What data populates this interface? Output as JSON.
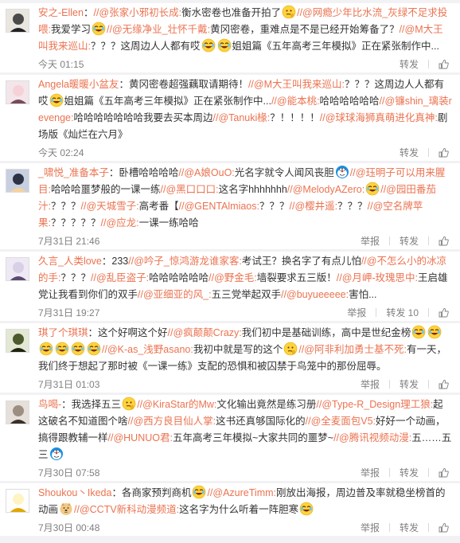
{
  "comments": [
    {
      "user": "安之-Ellen",
      "segments": [
        {
          "t": "p",
          "v": "："
        },
        {
          "t": "m",
          "v": "//@张家小邪初长成:"
        },
        {
          "t": "p",
          "v": "衡水密卷也准备开拍了"
        },
        {
          "t": "e",
          "v": "think"
        },
        {
          "t": "m",
          "v": "//@网瘾少年比水流_灰绿不足求投喂:"
        },
        {
          "t": "p",
          "v": "我爱学习"
        },
        {
          "t": "e",
          "v": "lol"
        },
        {
          "t": "m",
          "v": "//@无缘净业_壮怀千戴:"
        },
        {
          "t": "p",
          "v": "黄冈密卷，重难点是不是已经开始筹备了？"
        },
        {
          "t": "m",
          "v": "//@M大王叫我来巡山:"
        },
        {
          "t": "p",
          "v": "？？？这周边人人都有哎"
        },
        {
          "t": "e",
          "v": "lol"
        },
        {
          "t": "e",
          "v": "lol"
        },
        {
          "t": "p",
          "v": "姐姐篇《五年高考三年模拟》正在紧张制作中..."
        }
      ],
      "time": "今天 01:15",
      "actions": [
        "转发",
        "赞"
      ]
    },
    {
      "user": "Angela暖暖小盆友",
      "segments": [
        {
          "t": "p",
          "v": "：黄冈密卷超强藕取请期待！"
        },
        {
          "t": "m",
          "v": "//@M大王叫我来巡山:"
        },
        {
          "t": "p",
          "v": "？？？这周边人人都有哎"
        },
        {
          "t": "e",
          "v": "lol"
        },
        {
          "t": "p",
          "v": "姐姐篇《五年高考三年模拟》正在紧张制作中..."
        },
        {
          "t": "m",
          "v": "//@能本桃:"
        },
        {
          "t": "p",
          "v": "哈哈哈哈哈哈"
        },
        {
          "t": "m",
          "v": "//@镰shin_璃装revenge:"
        },
        {
          "t": "p",
          "v": "哈哈哈哈哈哈哈我要去买本周边"
        },
        {
          "t": "m",
          "v": "//@Tanuki椽:"
        },
        {
          "t": "p",
          "v": "？！！！！"
        },
        {
          "t": "m",
          "v": "//@球球海狮真萌进化真神:"
        },
        {
          "t": "p",
          "v": "剧场版《灿烂在六月》"
        }
      ],
      "time": "今天 02:24",
      "actions": [
        "转发",
        "赞"
      ]
    },
    {
      "user": "_啸悦_准备本子",
      "segments": [
        {
          "t": "p",
          "v": "：卧槽哈哈哈哈"
        },
        {
          "t": "m",
          "v": "//@A娘OuO:"
        },
        {
          "t": "p",
          "v": "光名字就令人闻风丧胆"
        },
        {
          "t": "e",
          "v": "doraemon"
        },
        {
          "t": "m",
          "v": "//@珏明子可以用来腥目:"
        },
        {
          "t": "p",
          "v": "哈哈哈噩梦般的一课一练"
        },
        {
          "t": "m",
          "v": "//@黑口口口:"
        },
        {
          "t": "p",
          "v": "这名字hhhhhhh"
        },
        {
          "t": "m",
          "v": "//@MelodyAZero:"
        },
        {
          "t": "e",
          "v": "lol"
        },
        {
          "t": "m",
          "v": "//@园田番茄汁:"
        },
        {
          "t": "p",
          "v": "？？？"
        },
        {
          "t": "m",
          "v": "//@天城雪子:"
        },
        {
          "t": "p",
          "v": "高考番【"
        },
        {
          "t": "m",
          "v": "//@GENTAlmiaos:"
        },
        {
          "t": "p",
          "v": "？？？"
        },
        {
          "t": "m",
          "v": "//@樱井遥:"
        },
        {
          "t": "p",
          "v": "？？？"
        },
        {
          "t": "m",
          "v": "//@空名牌苹果:"
        },
        {
          "t": "p",
          "v": "？？？？？"
        },
        {
          "t": "m",
          "v": "//@应龙:"
        },
        {
          "t": "p",
          "v": "一课一练哈哈"
        }
      ],
      "time": "7月31日 21:46",
      "actions": [
        "举报",
        "转发",
        "赞"
      ]
    },
    {
      "user": "久言_人类love",
      "segments": [
        {
          "t": "p",
          "v": "：233"
        },
        {
          "t": "m",
          "v": "//@吟子_惊鸿游龙谁家客:"
        },
        {
          "t": "p",
          "v": "考试王？换名字了有点儿怕"
        },
        {
          "t": "m",
          "v": "//@不怎么小的冰凉的手:"
        },
        {
          "t": "p",
          "v": "？？？"
        },
        {
          "t": "m",
          "v": "//@乱臣盗子:"
        },
        {
          "t": "p",
          "v": "哈哈哈哈哈哈"
        },
        {
          "t": "m",
          "v": "//@野金毛:"
        },
        {
          "t": "p",
          "v": "墙裂要求五三版！"
        },
        {
          "t": "m",
          "v": "//@月岬-玫瑰思中:"
        },
        {
          "t": "p",
          "v": "王启雄党让我看到你们的双手"
        },
        {
          "t": "m",
          "v": "//@亚细亚的风_:"
        },
        {
          "t": "p",
          "v": "五三党举起双手"
        },
        {
          "t": "m",
          "v": "//@buyueeeee:"
        },
        {
          "t": "p",
          "v": "害怕..."
        }
      ],
      "time": "7月31日 19:27",
      "actions": [
        "举报",
        "转发 10",
        "赞"
      ]
    },
    {
      "user": "琪了个琪琪",
      "segments": [
        {
          "t": "p",
          "v": "：这个好啊这个好"
        },
        {
          "t": "m",
          "v": "//@疯颠颠Crazy:"
        },
        {
          "t": "p",
          "v": "我们初中是基础训练，高中是世纪金榜"
        },
        {
          "t": "e",
          "v": "lol"
        },
        {
          "t": "e",
          "v": "lol"
        },
        {
          "t": "e",
          "v": "lol"
        },
        {
          "t": "e",
          "v": "lol"
        },
        {
          "t": "e",
          "v": "lol"
        },
        {
          "t": "e",
          "v": "lol"
        },
        {
          "t": "m",
          "v": "//@K-as_浅野asano:"
        },
        {
          "t": "p",
          "v": "我初中就是写的这个"
        },
        {
          "t": "e",
          "v": "think"
        },
        {
          "t": "m",
          "v": "//@阿非利加勇士基不死:"
        },
        {
          "t": "p",
          "v": "有一天，我们终于想起了那时被《一课一练》支配的恐惧和被囚禁于鸟笼中的那份屈辱。"
        }
      ],
      "time": "7月31日 01:03",
      "actions": [
        "举报",
        "转发",
        "赞"
      ]
    },
    {
      "user": "鸟喝-",
      "segments": [
        {
          "t": "p",
          "v": "：我选择五三"
        },
        {
          "t": "e",
          "v": "think"
        },
        {
          "t": "m",
          "v": "//@KiraStar的Mw:"
        },
        {
          "t": "p",
          "v": "文化输出竟然是练习册"
        },
        {
          "t": "m",
          "v": "//@Type-R_Design理工狼:"
        },
        {
          "t": "p",
          "v": "起这破名不知道图个啥"
        },
        {
          "t": "m",
          "v": "//@西方良目仙人掌:"
        },
        {
          "t": "p",
          "v": "这书还真够国际化的"
        },
        {
          "t": "m",
          "v": "//@全麦面包V5:"
        },
        {
          "t": "p",
          "v": "好好一个动画，搞得跟教辅一样"
        },
        {
          "t": "m",
          "v": "//@HUNUO君:"
        },
        {
          "t": "p",
          "v": "五年高考三年模拟~大家共同的噩梦~"
        },
        {
          "t": "m",
          "v": "//@腾讯视频动漫:"
        },
        {
          "t": "p",
          "v": "五……五三"
        },
        {
          "t": "e",
          "v": "doraemon"
        }
      ],
      "time": "7月30日 07:58",
      "actions": [
        "举报",
        "转发",
        "赞"
      ]
    },
    {
      "user": "Shoukou丶Ikeda",
      "segments": [
        {
          "t": "p",
          "v": "：各商家预判商机"
        },
        {
          "t": "e",
          "v": "lol"
        },
        {
          "t": "m",
          "v": "//@AzureTimm:"
        },
        {
          "t": "p",
          "v": "刚放出海报，周边普及率就稳坐榜首的动画"
        },
        {
          "t": "e",
          "v": "doge"
        },
        {
          "t": "m",
          "v": "//@CCTV新科动漫频道:"
        },
        {
          "t": "p",
          "v": "这名字为什么听着一阵胆寒"
        },
        {
          "t": "e",
          "v": "lol"
        }
      ],
      "time": "7月30日 00:48",
      "actions": [
        "举报",
        "转发",
        "赞"
      ]
    }
  ],
  "colors": {
    "username": "#eb7350",
    "mention": "#eb7350",
    "text": "#333333",
    "meta": "#808080",
    "background": "#f2f2f5"
  }
}
